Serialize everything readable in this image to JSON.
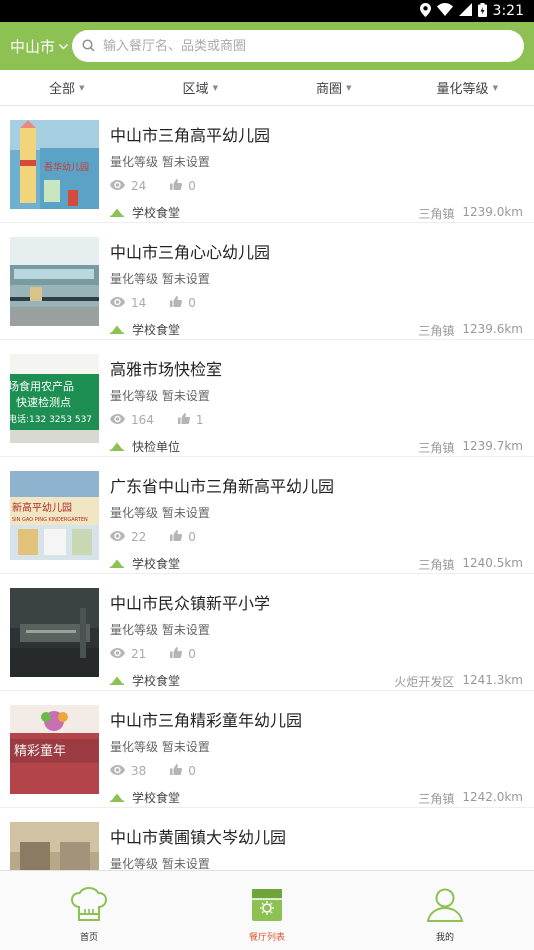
{
  "status_bar": {
    "time": "3:21"
  },
  "header": {
    "city": "中山市",
    "search_placeholder": "输入餐厅名、品类或商圈"
  },
  "filters": [
    "全部",
    "区域",
    "商圈",
    "量化等级"
  ],
  "list": [
    {
      "name": "中山市三角高平幼儿园",
      "level": "量化等级 暂未设置",
      "views": "24",
      "likes": "0",
      "type": "学校食堂",
      "area": "三角镇",
      "distance": "1239.0km"
    },
    {
      "name": "中山市三角心心幼儿园",
      "level": "量化等级 暂未设置",
      "views": "14",
      "likes": "0",
      "type": "学校食堂",
      "area": "三角镇",
      "distance": "1239.6km"
    },
    {
      "name": "高雅市场快检室",
      "level": "量化等级 暂未设置",
      "views": "164",
      "likes": "1",
      "type": "快检单位",
      "area": "三角镇",
      "distance": "1239.7km"
    },
    {
      "name": "广东省中山市三角新高平幼儿园",
      "level": "量化等级 暂未设置",
      "views": "22",
      "likes": "0",
      "type": "学校食堂",
      "area": "三角镇",
      "distance": "1240.5km"
    },
    {
      "name": "中山市民众镇新平小学",
      "level": "量化等级 暂未设置",
      "views": "21",
      "likes": "0",
      "type": "学校食堂",
      "area": "火炬开发区",
      "distance": "1241.3km"
    },
    {
      "name": "中山市三角精彩童年幼儿园",
      "level": "量化等级 暂未设置",
      "views": "38",
      "likes": "0",
      "type": "学校食堂",
      "area": "三角镇",
      "distance": "1242.0km"
    },
    {
      "name": "中山市黄圃镇大岑幼儿园",
      "level": "量化等级 暂未设置",
      "views": "",
      "likes": "",
      "type": "",
      "area": "",
      "distance": ""
    }
  ],
  "thumb_text": {
    "t1": "吾华幼儿园",
    "t3_line1": "场食用农产品",
    "t3_line2": "快速检测点",
    "t3_line3": "电话:132 3253 537",
    "t4_line1": "新高平幼儿园",
    "t4_line2": "SIN GAO PING KINDERGARTEN",
    "t6": "精彩童年"
  },
  "tabbar": [
    {
      "label": "首页"
    },
    {
      "label": "餐厅列表"
    },
    {
      "label": "我的"
    }
  ],
  "colors": {
    "brand_green": "#8dc153",
    "active_tab": "#e0552e"
  }
}
